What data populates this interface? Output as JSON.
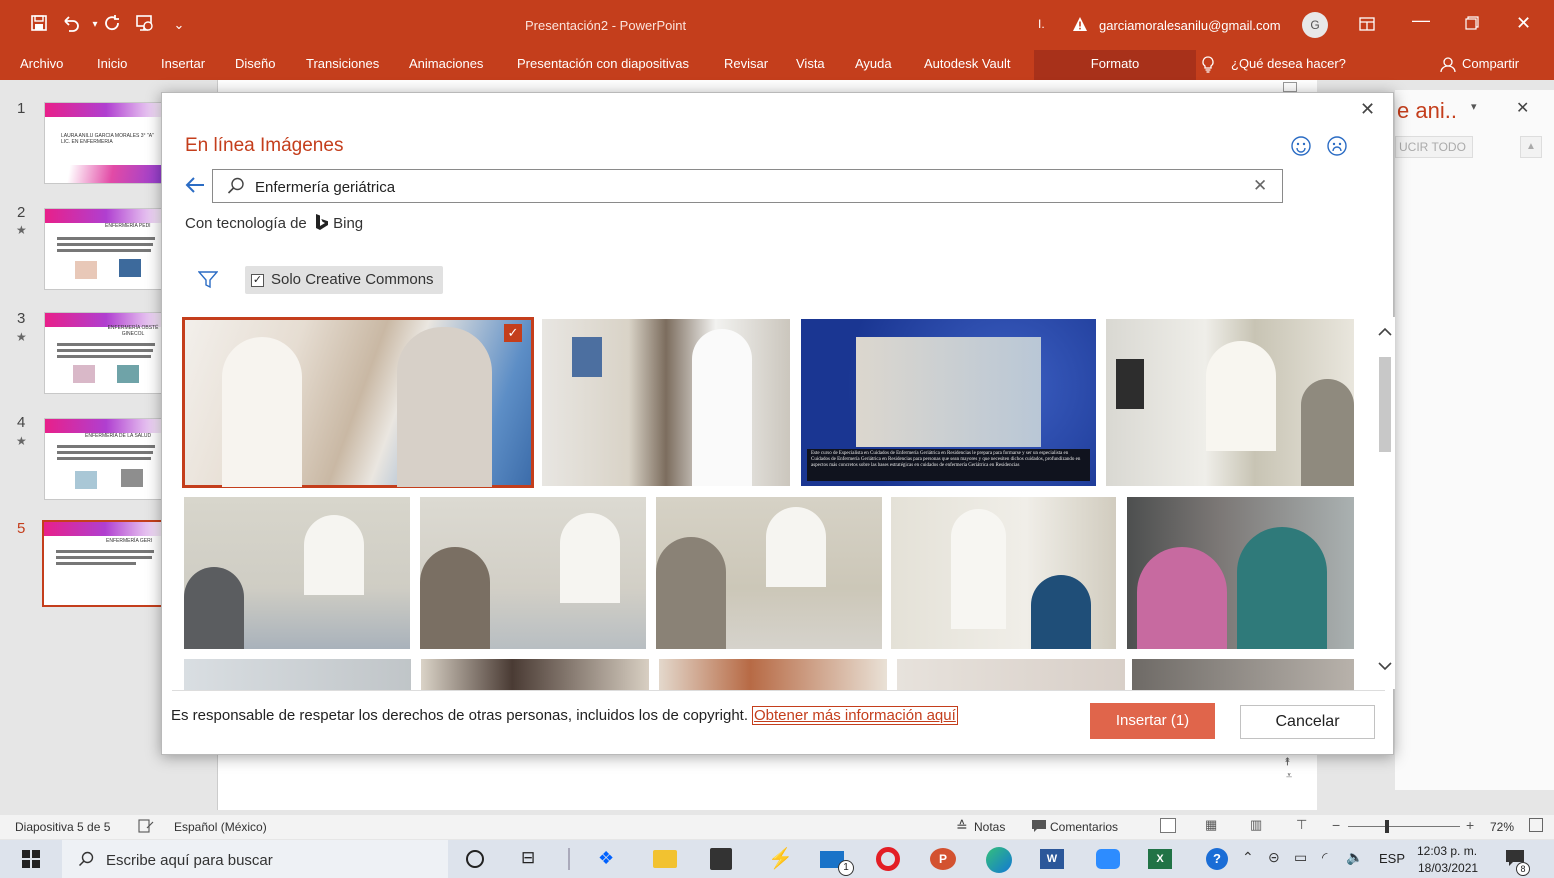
{
  "titlebar": {
    "doc_title": "Presentación2 - PowerPoint",
    "account_email": "garciamoralesanilu@gmail.com",
    "avatar_initial": "G",
    "qat_dropdown": "⌄"
  },
  "ribbon": {
    "tabs": [
      "Archivo",
      "Inicio",
      "Insertar",
      "Diseño",
      "Transiciones",
      "Animaciones",
      "Presentación con diapositivas",
      "Revisar",
      "Vista",
      "Ayuda",
      "Autodesk Vault"
    ],
    "context_tab": "Formato",
    "tell_me": "¿Qué desea hacer?",
    "share": "Compartir"
  },
  "slides": [
    {
      "number": "1",
      "star": "",
      "title": "LAURA ANILU GARCIA MORALES 3° \"A\" LIC. EN ENFERMERIA"
    },
    {
      "number": "2",
      "star": "★",
      "title": "ENFERMERÍA PEDI"
    },
    {
      "number": "3",
      "star": "★",
      "title": "ENFERMERÍA OBSTÉ GINECOL"
    },
    {
      "number": "4",
      "star": "★",
      "title": "ENFERMERÍA DE LA SALUD"
    },
    {
      "number": "5",
      "star": "",
      "title": "ENFERMERÍA GERI"
    }
  ],
  "right_pane": {
    "title": "e ani..",
    "button": "UCIR TODO"
  },
  "dialog": {
    "title": "En línea Imágenes",
    "search_value": "Enfermería geriátrica",
    "powered_by_prefix": "Con tecnología de",
    "powered_by_brand": "Bing",
    "filter_label": "Solo Creative Commons",
    "image_caption": "Este curso de Especialista en Cuidados de Enfermería Geriátrica en Residencias le prepara para formarse y ser un especialista en Cuidados de Enfermería Geriátrica en Residencias para personas que sean mayores y que necesiten dichos cuidados, profundizando en aspectos más concretos sobre las bases estratégicas en cuidados de enfermería Geriátrica en Residencias",
    "legal_text": "Es responsable de respetar los derechos de otras personas, incluidos los de copyright.",
    "legal_link": "Obtener más información aquí",
    "insert_button": "Insertar (1)",
    "cancel_button": "Cancelar"
  },
  "statusbar": {
    "slide_info": "Diapositiva 5 de 5",
    "language": "Español (México)",
    "notes": "Notas",
    "comments": "Comentarios",
    "zoom": "72%"
  },
  "taskbar": {
    "search_placeholder": "Escribe aquí para buscar",
    "lang": "ESP",
    "time": "12:03 p. m.",
    "date": "18/03/2021",
    "mail_badge": "1",
    "notif_count": "8"
  }
}
